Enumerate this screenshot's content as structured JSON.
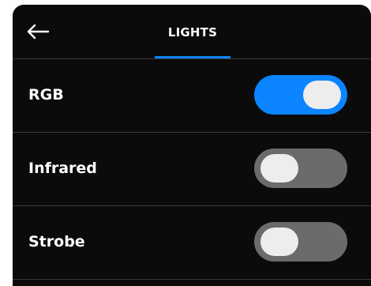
{
  "header": {
    "back_icon": "arrow-left-icon",
    "tab_label": "LIGHTS",
    "accent_color": "#0a84ff"
  },
  "settings": [
    {
      "label": "RGB",
      "enabled": true
    },
    {
      "label": "Infrared",
      "enabled": false
    },
    {
      "label": "Strobe",
      "enabled": false
    }
  ]
}
